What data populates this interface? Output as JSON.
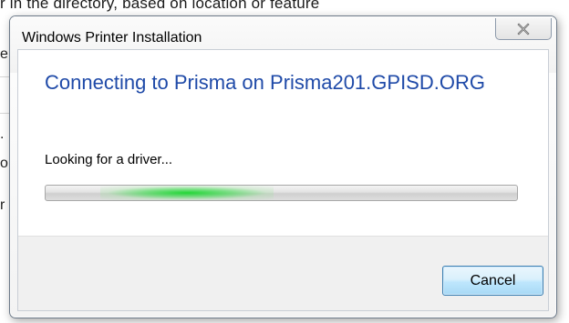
{
  "background": {
    "top_text": "r in the directory, based on location or feature",
    "fragments": [
      "e",
      ".",
      "o",
      "r"
    ]
  },
  "dialog": {
    "title": "Windows Printer Installation",
    "main_instruction": "Connecting to Prisma on Prisma201.GPISD.ORG",
    "status_text": "Looking for a driver...",
    "cancel_label": "Cancel",
    "close_icon": "close-x-icon",
    "accent_color": "#1f4aa8",
    "progress_color": "#19d62e",
    "progress_state": "marquee"
  }
}
